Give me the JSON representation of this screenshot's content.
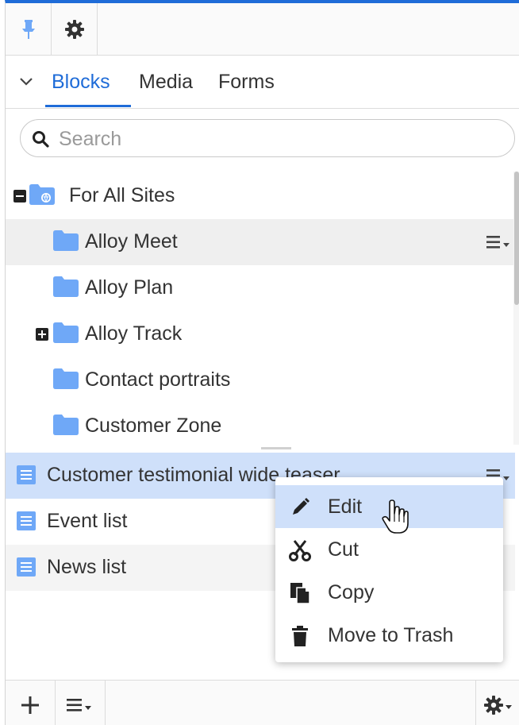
{
  "toolbar": {
    "pin_icon": "pin-icon",
    "settings_icon": "gear-icon"
  },
  "tabs": [
    {
      "label": "Blocks",
      "active": true
    },
    {
      "label": "Media",
      "active": false
    },
    {
      "label": "Forms",
      "active": false
    }
  ],
  "search": {
    "placeholder": "Search",
    "value": ""
  },
  "tree": {
    "root": {
      "label": "For All Sites",
      "expanded": true
    },
    "folders": [
      {
        "label": "Alloy Meet",
        "hovered": true
      },
      {
        "label": "Alloy Plan"
      },
      {
        "label": "Alloy Track",
        "expandable": true
      },
      {
        "label": "Contact portraits"
      },
      {
        "label": "Customer Zone"
      }
    ]
  },
  "blocks": [
    {
      "label": "Customer testimonial wide teaser",
      "selected": true
    },
    {
      "label": "Event list"
    },
    {
      "label": "News list"
    }
  ],
  "context_menu": {
    "items": [
      {
        "label": "Edit",
        "icon": "pencil-icon",
        "active": true
      },
      {
        "label": "Cut",
        "icon": "scissors-icon"
      },
      {
        "label": "Copy",
        "icon": "copy-icon"
      },
      {
        "label": "Move to Trash",
        "icon": "trash-icon"
      }
    ]
  },
  "bottom_toolbar": {
    "add_icon": "plus-icon",
    "menu_icon": "menu-icon",
    "settings_icon": "gear-icon"
  },
  "colors": {
    "accent": "#1f6cd8",
    "folder": "#6fa8f7",
    "selected_row": "#cfe0fa",
    "hover_row": "#efefef"
  }
}
